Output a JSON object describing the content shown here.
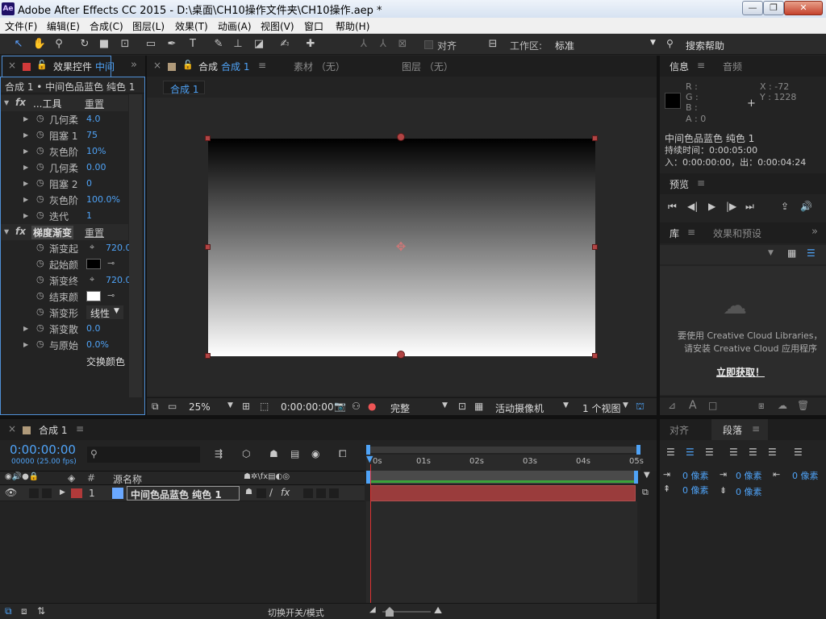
{
  "window": {
    "app_icon": "Ae",
    "title": "Adobe After Effects CC 2015 - D:\\桌面\\CH10操作文件夹\\CH10操作.aep *"
  },
  "menu": [
    "文件(F)",
    "编辑(E)",
    "合成(C)",
    "图层(L)",
    "效果(T)",
    "动画(A)",
    "视图(V)",
    "窗口",
    "帮助(H)"
  ],
  "toolbar": {
    "align_label": "对齐",
    "workspace_label": "工作区:",
    "workspace_value": "标准",
    "search_help": "搜索帮助"
  },
  "effects_panel": {
    "tab_label": "效果控件",
    "tab_suffix": "中间",
    "header": "合成 1 • 中间色品蓝色 纯色 1",
    "group1": {
      "name": "...工具",
      "reset": "重置"
    },
    "group1_rows": [
      {
        "label": "几何柔",
        "value": "4.0"
      },
      {
        "label": "阻塞 1",
        "value": "75"
      },
      {
        "label": "灰色阶",
        "value": "10%"
      },
      {
        "label": "几何柔",
        "value": "0.00"
      },
      {
        "label": "阻塞 2",
        "value": "0"
      },
      {
        "label": "灰色阶",
        "value": "100.0%"
      },
      {
        "label": "迭代",
        "value": "1"
      }
    ],
    "group2": {
      "name": "梯度渐变",
      "reset": "重置"
    },
    "group2_rows": {
      "start": {
        "label": "渐变起",
        "value": "720.0"
      },
      "start_color": {
        "label": "起始颜"
      },
      "end": {
        "label": "渐变终",
        "value": "720.0"
      },
      "end_color": {
        "label": "结束颜"
      },
      "shape": {
        "label": "渐变形",
        "value": "线性"
      },
      "scatter": {
        "label": "渐变散",
        "value": "0.0"
      },
      "blend": {
        "label": "与原始",
        "value": "0.0%"
      },
      "swap": "交换颜色"
    }
  },
  "comp_panel": {
    "tab_label": "合成",
    "tab_name": "合成 1",
    "footage_tab": "素材 （无）",
    "layer_tab": "图层 （无）",
    "sub_tab": "合成 1",
    "bottom": {
      "zoom": "25%",
      "timecode": "0:00:00:00",
      "resolution": "完整",
      "camera": "活动摄像机",
      "views": "1 个视图"
    }
  },
  "info_panel": {
    "tab_info": "信息",
    "tab_audio": "音频",
    "r": "R :",
    "g": "G :",
    "b": "B :",
    "a": "A : 0",
    "x": "X : -72",
    "y": "Y : 1228",
    "layer_name": "中间色品蓝色 纯色 1",
    "duration": "持续时间：0:00:05:00",
    "inout": "入：0:00:00:00，出：0:00:04:24"
  },
  "preview_panel": {
    "tab": "预览"
  },
  "library_panel": {
    "tab": "库",
    "tab_effects": "效果和预设",
    "message_line1": "要使用 Creative Cloud Libraries，",
    "message_line2": "请安装 Creative Cloud 应用程序",
    "link": "立即获取！"
  },
  "timeline": {
    "tab": "合成 1",
    "timecode": "0:00:00:00",
    "fps": "00000 (25.00 fps)",
    "search_placeholder": "",
    "col_hash": "#",
    "col_source": "源名称",
    "layer_number": "1",
    "layer_name": "中间色品蓝色 纯色 1",
    "ruler": [
      "0s",
      "01s",
      "02s",
      "03s",
      "04s",
      "05s"
    ],
    "bottom_toggle": "切换开关/模式",
    "layer_color": "#b13a3a",
    "bar_color": "#9a3c3c"
  },
  "paragraph_panel": {
    "tab_align": "对齐",
    "tab_paragraph": "段落",
    "indent1": "0 像素",
    "indent2": "0 像素",
    "indent3": "0 像素",
    "space1": "0 像素",
    "space2": "0 像素"
  }
}
